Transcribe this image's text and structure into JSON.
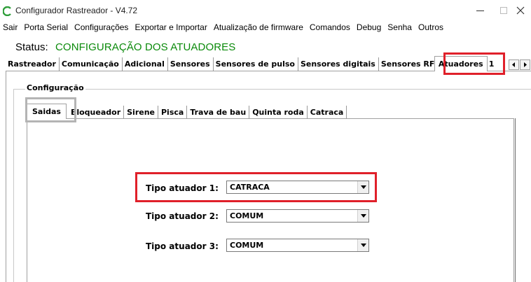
{
  "window": {
    "title": "Configurador Rastreador - V4.72",
    "minimize_glyph": "–",
    "maximize_glyph": "□",
    "close_glyph": "✕",
    "icon": "app-logo-icon",
    "icon_color": "#2e9e3a"
  },
  "menu": {
    "items": [
      {
        "label": "Sair"
      },
      {
        "label": "Porta Serial"
      },
      {
        "label": "Configurações"
      },
      {
        "label": "Exportar e Importar"
      },
      {
        "label": "Atualização de firmware"
      },
      {
        "label": "Comandos"
      },
      {
        "label": "Debug"
      },
      {
        "label": "Senha"
      },
      {
        "label": "Outros"
      }
    ]
  },
  "status": {
    "label": "Status:",
    "value": "CONFIGURAÇÃO DOS ATUADORES",
    "value_color": "#0a8a0a"
  },
  "main_tabs": {
    "items": [
      {
        "label": "Rastreador"
      },
      {
        "label": "Comunicação"
      },
      {
        "label": "Adicional"
      },
      {
        "label": "Sensores"
      },
      {
        "label": "Sensores de pulso"
      },
      {
        "label": "Sensores digitais"
      },
      {
        "label": "Sensores RF"
      },
      {
        "label": "Atuadores"
      },
      {
        "label": "1"
      }
    ],
    "active": "Atuadores",
    "scroll_left": "◂",
    "scroll_right": "▸"
  },
  "group": {
    "legend": "Configuração"
  },
  "sub_tabs": {
    "items": [
      {
        "label": "Saidas"
      },
      {
        "label": "Bloqueador"
      },
      {
        "label": "Sirene"
      },
      {
        "label": "Pisca"
      },
      {
        "label": "Trava de bau"
      },
      {
        "label": "Quinta roda"
      },
      {
        "label": "Catraca"
      }
    ],
    "active": "Saidas"
  },
  "form": {
    "rows": [
      {
        "label": "Tipo atuador 1:",
        "value": "CATRACA"
      },
      {
        "label": "Tipo atuador 2:",
        "value": "COMUM"
      },
      {
        "label": "Tipo atuador 3:",
        "value": "COMUM"
      }
    ]
  },
  "highlight_colors": {
    "red": "#e0202a",
    "gray": "#b4b4b4"
  }
}
